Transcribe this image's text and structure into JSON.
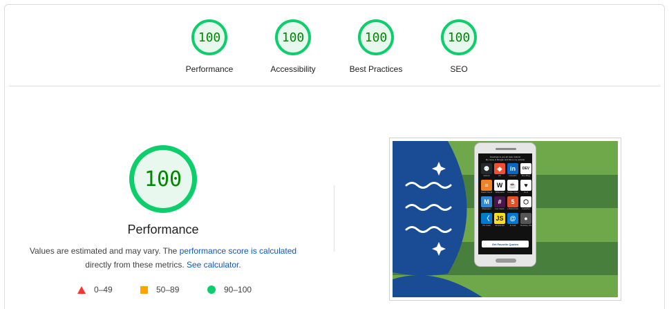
{
  "summary": {
    "gauges": [
      {
        "score": "100",
        "label": "Performance"
      },
      {
        "score": "100",
        "label": "Accessibility"
      },
      {
        "score": "100",
        "label": "Best Practices"
      },
      {
        "score": "100",
        "label": "SEO"
      }
    ]
  },
  "performance": {
    "score": "100",
    "title": "Performance",
    "desc_prefix": "Values are estimated and may vary. The ",
    "link_score": "performance score is calculated",
    "desc_middle": "directly from these metrics. ",
    "link_calculator": "See calculator.",
    "legend": [
      {
        "shape": "triangle",
        "range": "0–49",
        "color": "#ff3333"
      },
      {
        "shape": "square",
        "range": "50–89",
        "color": "#ffa400"
      },
      {
        "shape": "circle",
        "range": "90–100",
        "color": "#0cce6b"
      }
    ]
  },
  "screenshot": {
    "greeting_line1": "Greetings to you all, dear visitors!",
    "greeting_line2": "My name is Morgan and this is my website",
    "apps": [
      {
        "icon": "github-icon",
        "glyph": "⚉",
        "caption": "GitHub",
        "bg": "#24292e"
      },
      {
        "icon": "git-icon",
        "glyph": "◆",
        "caption": "Git",
        "bg": "#f05032"
      },
      {
        "icon": "linkedin-icon",
        "glyph": "in",
        "caption": "LinkedIn",
        "bg": "#0a66c2"
      },
      {
        "icon": "devto-icon",
        "glyph": "DEV",
        "caption": "Dev.Blog",
        "bg": "#ffffff"
      },
      {
        "icon": "stackoverflow-icon",
        "glyph": "≡",
        "caption": "Stack Overflow",
        "bg": "#f48024"
      },
      {
        "icon": "wikipedia-icon",
        "glyph": "W",
        "caption": "Wikipedia",
        "bg": "#ffffff"
      },
      {
        "icon": "coffee-icon",
        "glyph": "☕",
        "caption": "Coffee Date",
        "bg": "#ffffff"
      },
      {
        "icon": "kofi-icon",
        "glyph": "♥",
        "caption": "Ko-fi",
        "bg": "#ffffff"
      },
      {
        "icon": "mastodon-icon",
        "glyph": "M",
        "caption": "Mastodon",
        "bg": "#3088d4"
      },
      {
        "icon": "slack-icon",
        "glyph": "#",
        "caption": "Our Slack",
        "bg": "#4a154b"
      },
      {
        "icon": "html5-icon",
        "glyph": "5",
        "caption": "HTML/CSS",
        "bg": "#e34f26"
      },
      {
        "icon": "codepen-icon",
        "glyph": "⬡",
        "caption": "CodePen",
        "bg": "#ffffff"
      },
      {
        "icon": "vscode-icon",
        "glyph": "〈",
        "caption": "VS Code",
        "bg": "#007acc"
      },
      {
        "icon": "javascript-icon",
        "glyph": "JS",
        "caption": "JavaScript",
        "bg": "#f7df1e"
      },
      {
        "icon": "email-icon",
        "glyph": "@",
        "caption": "E-mail",
        "bg": "#0078d4"
      },
      {
        "icon": "apple-icon",
        "glyph": "●",
        "caption": "Desktop OS",
        "bg": "#555555"
      }
    ],
    "button_label": "Get Favorite Quotes"
  }
}
